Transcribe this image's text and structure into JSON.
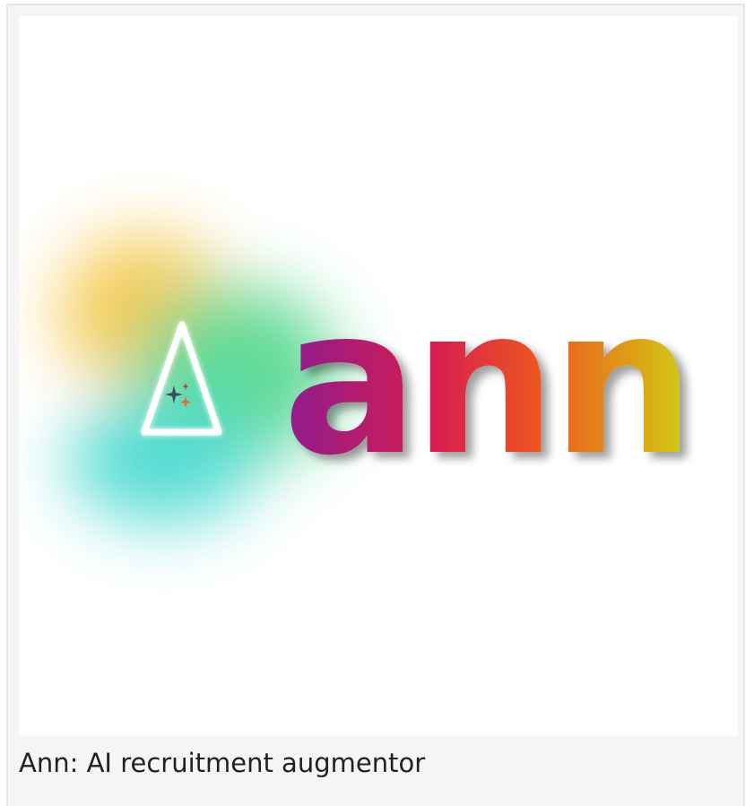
{
  "figure": {
    "logo_wordmark": "ann",
    "caption": "Ann: AI recruitment augmentor"
  },
  "icons": {
    "logo_mark": "triangle-sparkle-icon",
    "sparkle": "sparkle-icon"
  },
  "colors": {
    "glow_yellow": "#f6c53e",
    "glow_green": "#4fd68a",
    "glow_teal": "#3fd8cf",
    "triangle_stroke": "#ffffff",
    "word_gradient_start": "#8f1d8f",
    "word_gradient_mid1": "#d81f4e",
    "word_gradient_mid2": "#ef5a1c",
    "word_gradient_end": "#cfcf17",
    "sparkle_dark": "#3f4a5c",
    "sparkle_orange": "#e0702a",
    "sparkle_red": "#c0303a",
    "caption_text": "#222222",
    "card_bg": "#f5f5f5",
    "card_border": "#e6e6e6"
  }
}
